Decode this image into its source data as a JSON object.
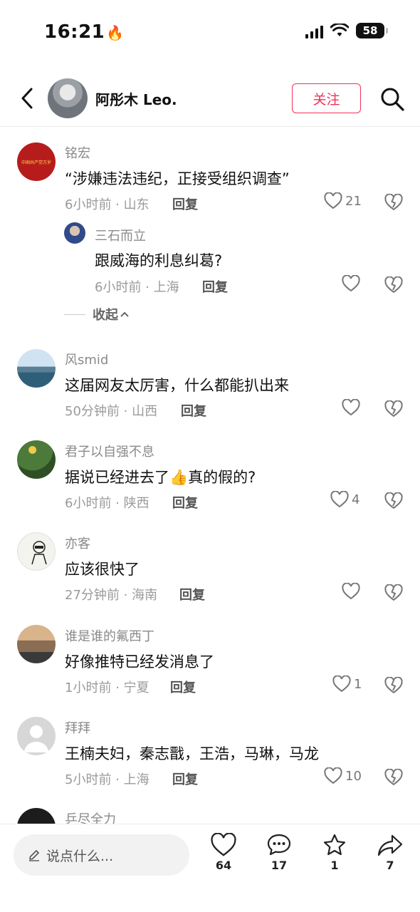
{
  "status_bar": {
    "time": "16:21",
    "battery": "58"
  },
  "header": {
    "author_name": "阿彤木 Leo.",
    "follow_label": "关注"
  },
  "comments": [
    {
      "user": "铭宏",
      "text": "“涉嫌违法违纪，正接受组织调查”",
      "time_location": "6小时前 · 山东",
      "reply_label": "回复",
      "likes": "21",
      "avatar_text": "中国共产党万岁"
    },
    {
      "user": "三石而立",
      "text": "跟威海的利息纠葛?",
      "time_location": "6小时前 · 上海",
      "reply_label": "回复",
      "likes": ""
    },
    {
      "user": "风smid",
      "text": "这届网友太厉害，什么都能扒出来",
      "time_location": "50分钟前 · 山西",
      "reply_label": "回复",
      "likes": ""
    },
    {
      "user": "君子以自强不息",
      "text": "据说已经进去了",
      "text_suffix": "真的假的?",
      "time_location": "6小时前 · 陕西",
      "reply_label": "回复",
      "likes": "4"
    },
    {
      "user": "亦客",
      "text": "应该很快了",
      "time_location": "27分钟前 · 海南",
      "reply_label": "回复",
      "likes": ""
    },
    {
      "user": "谁是谁的氟西丁",
      "text": "好像推特已经发消息了",
      "time_location": "1小时前 · 宁夏",
      "reply_label": "回复",
      "likes": "1"
    },
    {
      "user": "拜拜",
      "text": "王楠夫妇，秦志戬，王浩，马琳，马龙",
      "time_location": "5小时前 · 上海",
      "reply_label": "回复",
      "likes": "10"
    },
    {
      "user": "乒尽全力"
    }
  ],
  "collapse_label": "收起",
  "bottom_bar": {
    "input_placeholder": "说点什么...",
    "likes": "64",
    "comments": "17",
    "favorites": "1",
    "shares": "7"
  },
  "colors": {
    "accent": "#f0315a",
    "meta_text": "#9a9a9a",
    "username": "#8a8a8a"
  },
  "icons": [
    "back-arrow-icon",
    "search-icon",
    "heart-icon",
    "broken-heart-icon",
    "chat-bubble-icon",
    "star-icon",
    "share-arrow-icon",
    "pencil-icon",
    "chevron-up-icon",
    "thumbs-up-emoji"
  ]
}
